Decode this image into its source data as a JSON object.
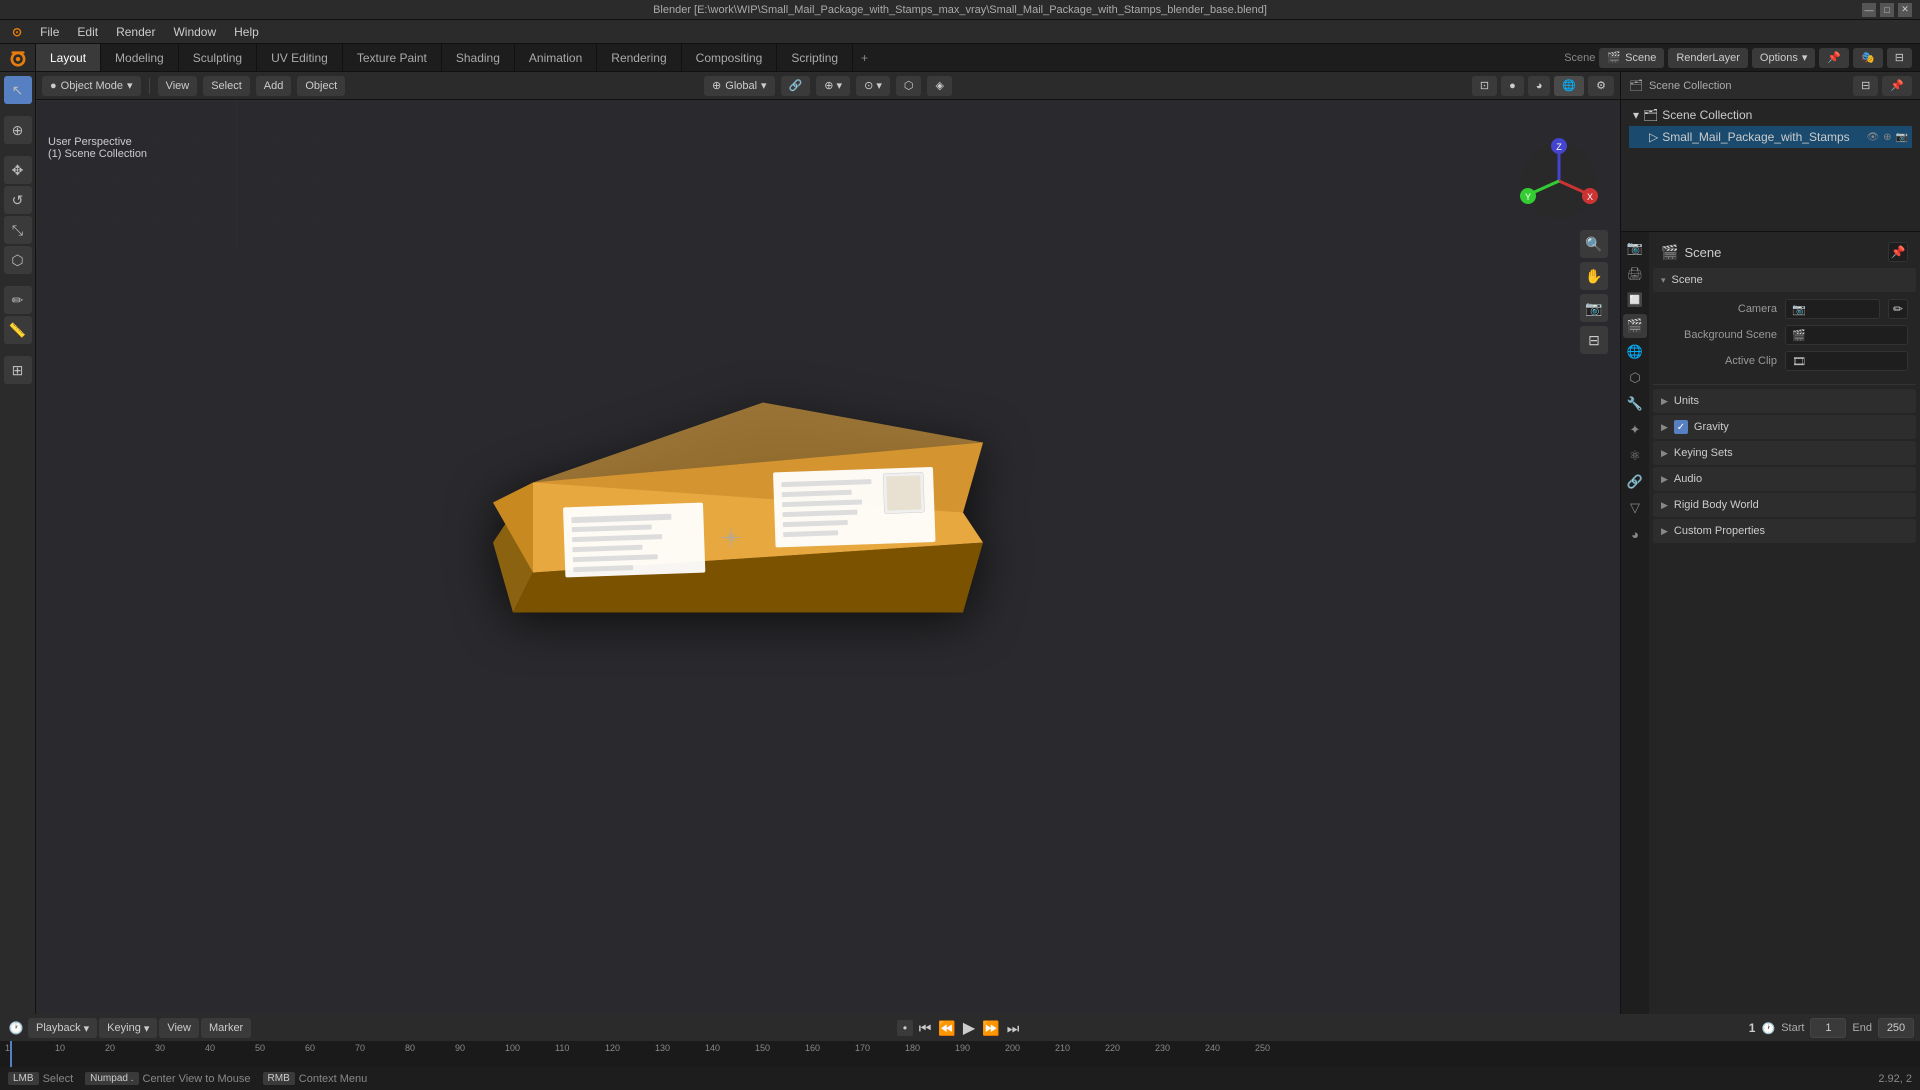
{
  "title_bar": {
    "title": "Blender [E:\\work\\WIP\\Small_Mail_Package_with_Stamps_max_vray\\Small_Mail_Package_with_Stamps_blender_base.blend]"
  },
  "menu": {
    "items": [
      "Blender",
      "File",
      "Edit",
      "Render",
      "Window",
      "Help"
    ]
  },
  "workspace_tabs": {
    "tabs": [
      "Layout",
      "Modeling",
      "Sculpting",
      "UV Editing",
      "Texture Paint",
      "Shading",
      "Animation",
      "Rendering",
      "Compositing",
      "Scripting"
    ],
    "active": "Layout",
    "add_label": "+"
  },
  "viewport": {
    "mode": "Object Mode",
    "view_label": "View",
    "select_label": "Select",
    "add_label": "Add",
    "object_label": "Object",
    "orientation": "Global",
    "snap_label": "Snap",
    "proportional_label": "Proportional",
    "view_info_line1": "User Perspective",
    "view_info_line2": "(1) Scene Collection"
  },
  "outliner": {
    "header": "Scene Collection",
    "items": [
      {
        "name": "Small_Mail_Package_with_Stamps",
        "icon": "▷",
        "active": true
      }
    ]
  },
  "properties": {
    "header_icon": "🎬",
    "header_title": "Scene",
    "section_title": "Scene",
    "camera_label": "Camera",
    "background_scene_label": "Background Scene",
    "active_clip_label": "Active Clip",
    "units_label": "Units",
    "gravity_label": "Gravity",
    "gravity_checked": true,
    "keying_sets_label": "Keying Sets",
    "audio_label": "Audio",
    "rigid_body_world_label": "Rigid Body World",
    "custom_properties_label": "Custom Properties"
  },
  "timeline": {
    "playback_label": "Playback",
    "keying_label": "Keying",
    "view_label": "View",
    "marker_label": "Marker",
    "current_frame": "1",
    "start_label": "Start",
    "start_value": "1",
    "end_label": "End",
    "end_value": "250",
    "frame_ticks": [
      "1",
      "10",
      "20",
      "30",
      "40",
      "50",
      "60",
      "70",
      "80",
      "90",
      "100",
      "110",
      "120",
      "130",
      "140",
      "150",
      "160",
      "170",
      "180",
      "190",
      "200",
      "210",
      "220",
      "230",
      "240",
      "250"
    ]
  },
  "status_bar": {
    "select_label": "Select",
    "center_view_label": "Center View to Mouse",
    "coords": "2.92, 2"
  },
  "render_layer": {
    "scene_label": "Scene",
    "render_layer_label": "RenderLayer",
    "options_label": "Options"
  }
}
